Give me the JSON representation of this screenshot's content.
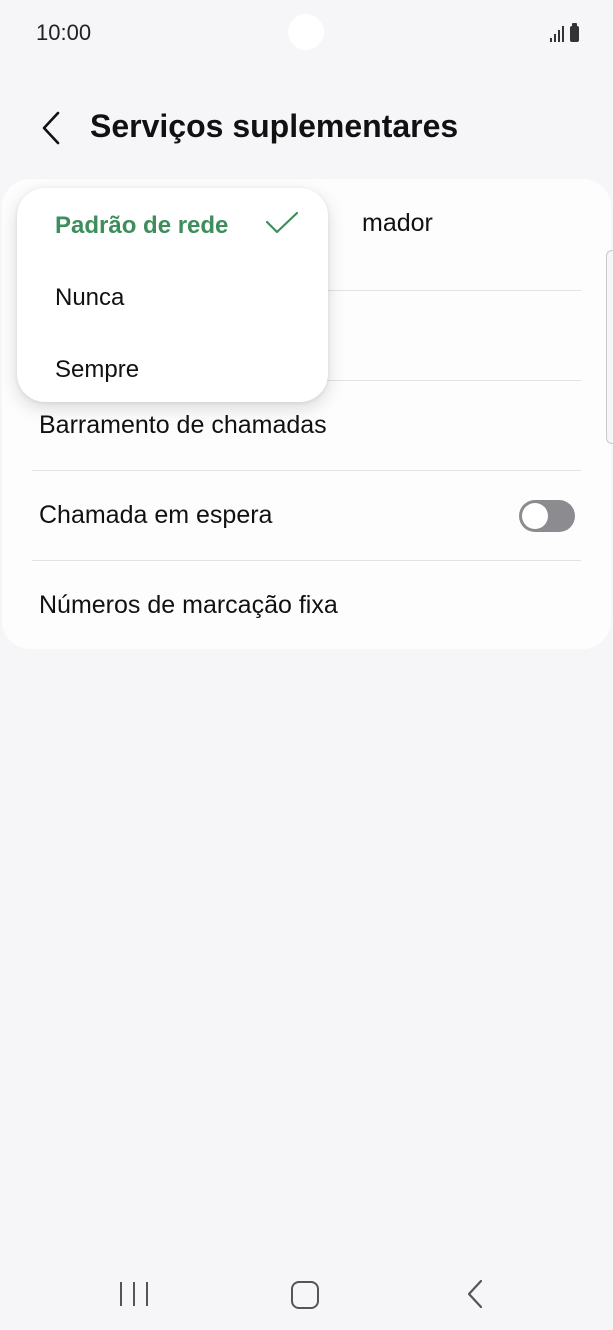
{
  "status_bar": {
    "time": "10:00"
  },
  "header": {
    "title": "Serviços suplementares",
    "back_icon": "chevron-left-icon"
  },
  "settings": {
    "rows": [
      {
        "label": "ID do chamador",
        "visible_fragment": "mador"
      },
      {
        "label": ""
      },
      {
        "label": "Barramento de chamadas"
      },
      {
        "label": "Chamada em espera",
        "toggle": false
      },
      {
        "label": "Números de marcação fixa"
      }
    ]
  },
  "popup": {
    "options": [
      {
        "label": "Padrão de rede",
        "selected": true
      },
      {
        "label": "Nunca",
        "selected": false
      },
      {
        "label": "Sempre",
        "selected": false
      }
    ],
    "selected_color": "#3e8e5c"
  },
  "nav_bar": {
    "recent_icon": "recent-apps-icon",
    "home_icon": "home-icon",
    "back_icon": "back-icon"
  }
}
